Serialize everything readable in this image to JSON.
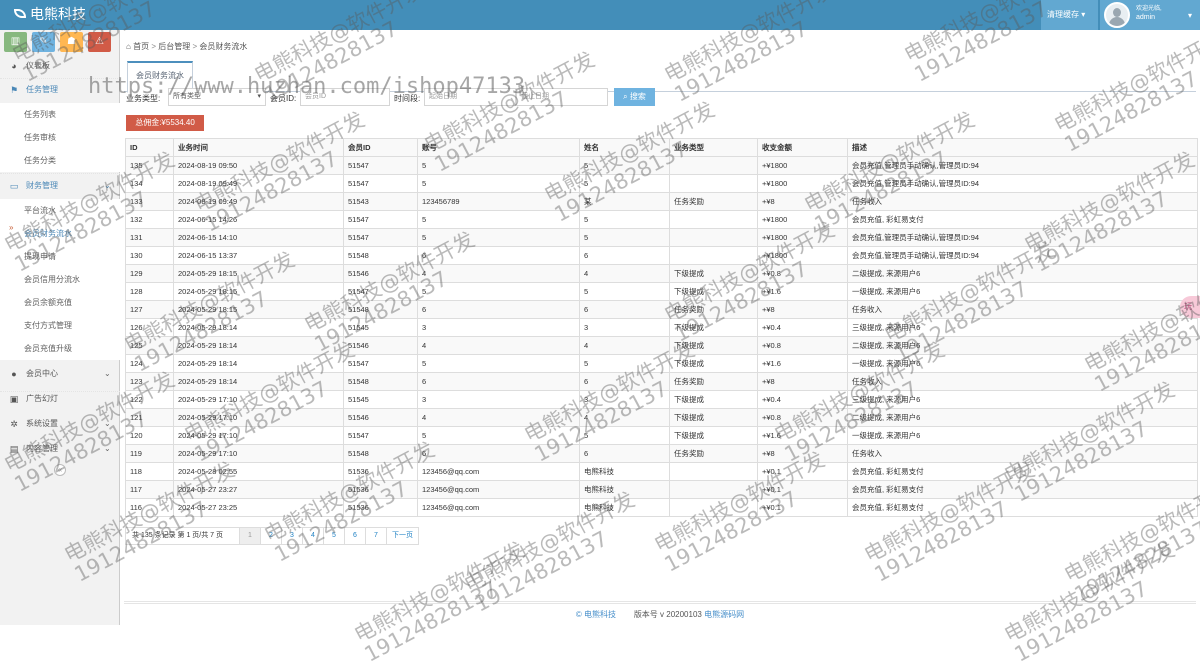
{
  "app": {
    "brand": "电熊科技"
  },
  "header": {
    "clear_cache": "清理缓存",
    "welcome": "欢迎光临,",
    "username": "admin"
  },
  "quick_buttons": [
    {
      "icon": "chart-icon",
      "color": "#87b87f",
      "glyph": "▥"
    },
    {
      "icon": "pencil-icon",
      "color": "#6fb3e0",
      "glyph": "✎"
    },
    {
      "icon": "users-icon",
      "color": "#ffb752",
      "glyph": "☗"
    },
    {
      "icon": "bell-icon",
      "color": "#d15b47",
      "glyph": "⚠"
    }
  ],
  "sidebar": {
    "dashboard": "仪表板",
    "tasks": "任务管理",
    "task_subs": [
      "任务列表",
      "任务审核",
      "任务分类"
    ],
    "finance": "财务管理",
    "finance_subs": [
      "平台流水",
      "会员财务流水",
      "提现申请",
      "会员信用分流水",
      "会员余额充值",
      "支付方式管理",
      "会员充值升级"
    ],
    "members": "会员中心",
    "ads": "广告幻灯",
    "settings": "系统设置",
    "content": "内容管理"
  },
  "breadcrumb": {
    "home": "首页",
    "level1": "后台管理",
    "level2": "会员财务流水"
  },
  "tab": {
    "label": "会员财务流水"
  },
  "filters": {
    "type_label": "业务类型:",
    "type_value": "所有类型",
    "member_label": "会员ID:",
    "member_placeholder": "会员ID",
    "time_label": "时间段:",
    "start_placeholder": "起始日期",
    "end_placeholder": "截止日期",
    "search_button": "搜索"
  },
  "total": {
    "text": "总佣金:¥5534.40"
  },
  "table": {
    "headers": [
      "ID",
      "业务时间",
      "会员ID",
      "账号",
      "姓名",
      "业务类型",
      "收支金额",
      "描述"
    ],
    "rows": [
      [
        "135",
        "2024-08-19 09:50",
        "51547",
        "5",
        "5",
        "",
        "+¥1800",
        "会员充值,管理员手动确认,管理员ID:94"
      ],
      [
        "134",
        "2024-08-19 09:49",
        "51547",
        "5",
        "5",
        "",
        "+¥1800",
        "会员充值,管理员手动确认,管理员ID:94"
      ],
      [
        "133",
        "2024-08-19 09:49",
        "51543",
        "123456789",
        "某",
        "任务奖励",
        "+¥8",
        "任务收入"
      ],
      [
        "132",
        "2024-06-15 14:26",
        "51547",
        "5",
        "5",
        "",
        "+¥1800",
        "会员充值, 彩虹易支付"
      ],
      [
        "131",
        "2024-06-15 14:10",
        "51547",
        "5",
        "5",
        "",
        "+¥1800",
        "会员充值,管理员手动确认,管理员ID:94"
      ],
      [
        "130",
        "2024-06-15 13:37",
        "51548",
        "6",
        "6",
        "",
        "+¥1800",
        "会员充值,管理员手动确认,管理员ID:94"
      ],
      [
        "129",
        "2024-05-29 18:15",
        "51546",
        "4",
        "4",
        "下级提成",
        "+¥0.8",
        "二级提成, 来源用户6"
      ],
      [
        "128",
        "2024-05-29 18:15",
        "51547",
        "5",
        "5",
        "下级提成",
        "+¥1.6",
        "一级提成, 来源用户6"
      ],
      [
        "127",
        "2024-05-29 18:15",
        "51548",
        "6",
        "6",
        "任务奖励",
        "+¥8",
        "任务收入"
      ],
      [
        "126",
        "2024-05-29 18:14",
        "51545",
        "3",
        "3",
        "下级提成",
        "+¥0.4",
        "三级提成, 来源用户6"
      ],
      [
        "125",
        "2024-05-29 18:14",
        "51546",
        "4",
        "4",
        "下级提成",
        "+¥0.8",
        "二级提成, 来源用户6"
      ],
      [
        "124",
        "2024-05-29 18:14",
        "51547",
        "5",
        "5",
        "下级提成",
        "+¥1.6",
        "一级提成, 来源用户6"
      ],
      [
        "123",
        "2024-05-29 18:14",
        "51548",
        "6",
        "6",
        "任务奖励",
        "+¥8",
        "任务收入"
      ],
      [
        "122",
        "2024-05-29 17:10",
        "51545",
        "3",
        "3",
        "下级提成",
        "+¥0.4",
        "三级提成, 来源用户6"
      ],
      [
        "121",
        "2024-05-29 17:10",
        "51546",
        "4",
        "4",
        "下级提成",
        "+¥0.8",
        "二级提成, 来源用户6"
      ],
      [
        "120",
        "2024-05-29 17:10",
        "51547",
        "5",
        "5",
        "下级提成",
        "+¥1.6",
        "一级提成, 来源用户6"
      ],
      [
        "119",
        "2024-05-29 17:10",
        "51548",
        "6",
        "6",
        "任务奖励",
        "+¥8",
        "任务收入"
      ],
      [
        "118",
        "2024-05-28 02:55",
        "51536",
        "123456@qq.com",
        "电熊科技",
        "",
        "+¥0.1",
        "会员充值, 彩虹易支付"
      ],
      [
        "117",
        "2024-05-27 23:27",
        "51536",
        "123456@qq.com",
        "电熊科技",
        "",
        "+¥0.1",
        "会员充值, 彩虹易支付"
      ],
      [
        "116",
        "2024-05-27 23:25",
        "51536",
        "123456@qq.com",
        "电熊科技",
        "",
        "+¥0.1",
        "会员充值, 彩虹易支付"
      ]
    ]
  },
  "pagination": {
    "summary": "共 135 条记录 第 1 页/共 7 页",
    "pages": [
      "1",
      "2",
      "3",
      "4",
      "5",
      "6",
      "7"
    ],
    "next": "下一页"
  },
  "footer": {
    "copyright": "© 电熊科技",
    "version": "版本号 v 20200103",
    "source": "电熊源码网"
  },
  "float_button": {
    "label": "玩"
  },
  "watermark": {
    "text": "电熊科技@软件开发\n19124828137",
    "url": "https://www.huzhan.com/ishop47133"
  }
}
